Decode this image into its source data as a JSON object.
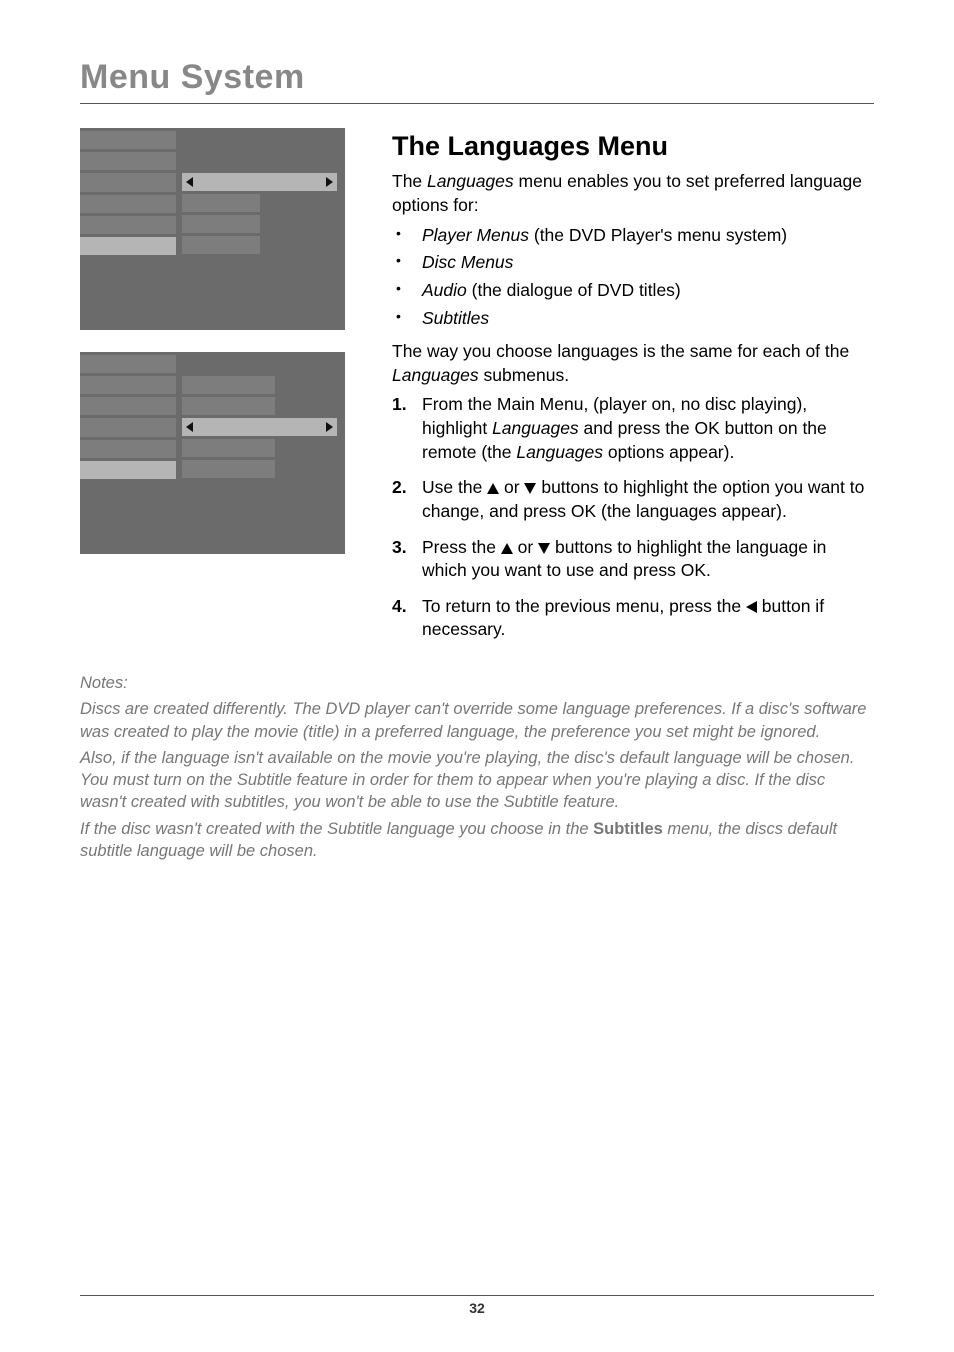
{
  "chapter": "Menu System",
  "section_heading": "The Languages Menu",
  "intro": "The ",
  "intro_em": "Languages",
  "intro_tail": " menu enables you to set preferred language options for:",
  "bullets": [
    {
      "pre": "",
      "em": "Player Menus",
      "post": " (the DVD Player's menu system)"
    },
    {
      "pre": "",
      "em": "Disc Menus",
      "post": ""
    },
    {
      "pre": "",
      "em": "Audio",
      "post": " (the dialogue of DVD titles)"
    },
    {
      "pre": "",
      "em": "Subtitles",
      "post": ""
    }
  ],
  "para2_a": "The way you choose languages is the same for each of the ",
  "para2_em": "Languages",
  "para2_b": " submenus.",
  "steps": {
    "s1_num": "1.",
    "s1_a": "From the Main Menu, (player on, no disc playing), highlight ",
    "s1_em1": "Languages",
    "s1_b": " and press the OK button on the remote (the ",
    "s1_em2": "Languages",
    "s1_c": " options appear).",
    "s2_num": "2.",
    "s2_a": "Use the ",
    "s2_b": " or ",
    "s2_c": " buttons to highlight the option you want to change, and press OK (the languages appear).",
    "s3_num": "3.",
    "s3_a": "Press the ",
    "s3_b": " or ",
    "s3_c": " buttons to highlight the language in which you want to use and press OK.",
    "s4_num": "4.",
    "s4_a": "To return to the previous menu, press the ",
    "s4_b": " button if necessary."
  },
  "notes": {
    "heading": "Notes:",
    "p1": "Discs are created differently. The DVD player can't override some language preferences. If a disc's software was created to play the movie (title) in a preferred language, the preference you set might be ignored.",
    "p2": "Also, if the language isn't available on the movie you're playing, the disc's default language will be chosen. You must turn on the Subtitle feature in order for them to appear when you're playing a disc. If the disc wasn't created with subtitles, you won't be able to use the Subtitle feature.",
    "p3_a": "If the disc wasn't created with the Subtitle language you choose in the ",
    "p3_bold": "Subtitles",
    "p3_b": " menu, the discs default subtitle language will be chosen."
  },
  "menu_images": {
    "img1_selected_index": 2,
    "img2_selected_index": 3
  },
  "page_number": "32"
}
